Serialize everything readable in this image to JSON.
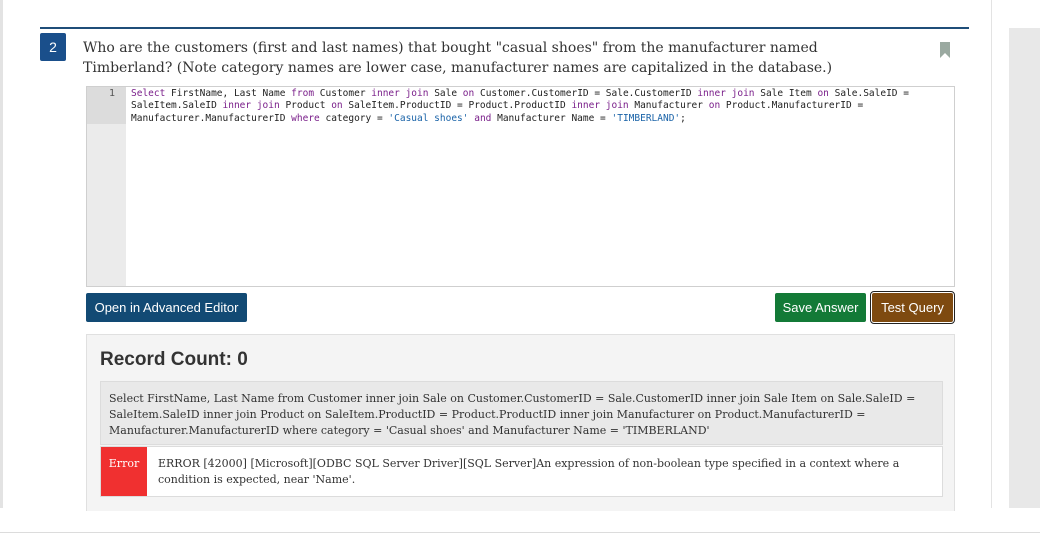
{
  "question": {
    "number": "2",
    "text": "Who are the customers (first and last names) that bought \"casual shoes\" from the manufacturer named Timberland? (Note category names are lower case, manufacturer names are capitalized in the database.)",
    "bookmark_icon": "bookmark-icon"
  },
  "editor": {
    "line_number": "1",
    "tokens": [
      {
        "t": "Select",
        "c": "kw"
      },
      {
        "t": " FirstName, Last Name ",
        "c": ""
      },
      {
        "t": "from",
        "c": "kw"
      },
      {
        "t": " Customer ",
        "c": ""
      },
      {
        "t": "inner join",
        "c": "kw"
      },
      {
        "t": " Sale ",
        "c": ""
      },
      {
        "t": "on",
        "c": "kw"
      },
      {
        "t": " Customer.CustomerID = Sale.CustomerID ",
        "c": ""
      },
      {
        "t": "inner join",
        "c": "kw"
      },
      {
        "t": " Sale Item ",
        "c": ""
      },
      {
        "t": "on",
        "c": "kw"
      },
      {
        "t": " Sale.SaleID = SaleItem.SaleID ",
        "c": ""
      },
      {
        "t": "inner join",
        "c": "kw"
      },
      {
        "t": " Product ",
        "c": ""
      },
      {
        "t": "on",
        "c": "kw"
      },
      {
        "t": " SaleItem.ProductID = Product.ProductID ",
        "c": ""
      },
      {
        "t": "inner join",
        "c": "kw"
      },
      {
        "t": " Manufacturer ",
        "c": ""
      },
      {
        "t": "on",
        "c": "kw"
      },
      {
        "t": " Product.ManufacturerID = Manufacturer.ManufacturerID ",
        "c": ""
      },
      {
        "t": "where",
        "c": "kw"
      },
      {
        "t": " category = ",
        "c": ""
      },
      {
        "t": "'Casual shoes'",
        "c": "str"
      },
      {
        "t": " ",
        "c": ""
      },
      {
        "t": "and",
        "c": "kw"
      },
      {
        "t": " Manufacturer Name = ",
        "c": ""
      },
      {
        "t": "'TIMBERLAND'",
        "c": "str"
      },
      {
        "t": ";",
        "c": ""
      }
    ]
  },
  "buttons": {
    "advanced_editor": "Open in Advanced Editor",
    "save_answer": "Save Answer",
    "test_query": "Test Query"
  },
  "result": {
    "record_count_label": "Record Count: 0",
    "sql_echo": "Select FirstName, Last Name from Customer inner join Sale on Customer.CustomerID = Sale.CustomerID inner join Sale Item on Sale.SaleID = SaleItem.SaleID inner join Product on SaleItem.ProductID = Product.ProductID inner join Manufacturer on Product.ManufacturerID = Manufacturer.ManufacturerID where category = 'Casual shoes' and Manufacturer Name = 'TIMBERLAND'",
    "error_label": "Error",
    "error_message": "ERROR [42000] [Microsoft][ODBC SQL Server Driver][SQL Server]An expression of non-boolean type specified in a context where a condition is expected, near 'Name'."
  },
  "colors": {
    "question_badge": "#1a4f8b",
    "advanced_button": "#124a74",
    "save_button": "#137a37",
    "test_button": "#7e4a10",
    "error_badge": "#f03030",
    "sql_keyword": "#7a1f8a",
    "sql_string": "#1a63a8"
  }
}
